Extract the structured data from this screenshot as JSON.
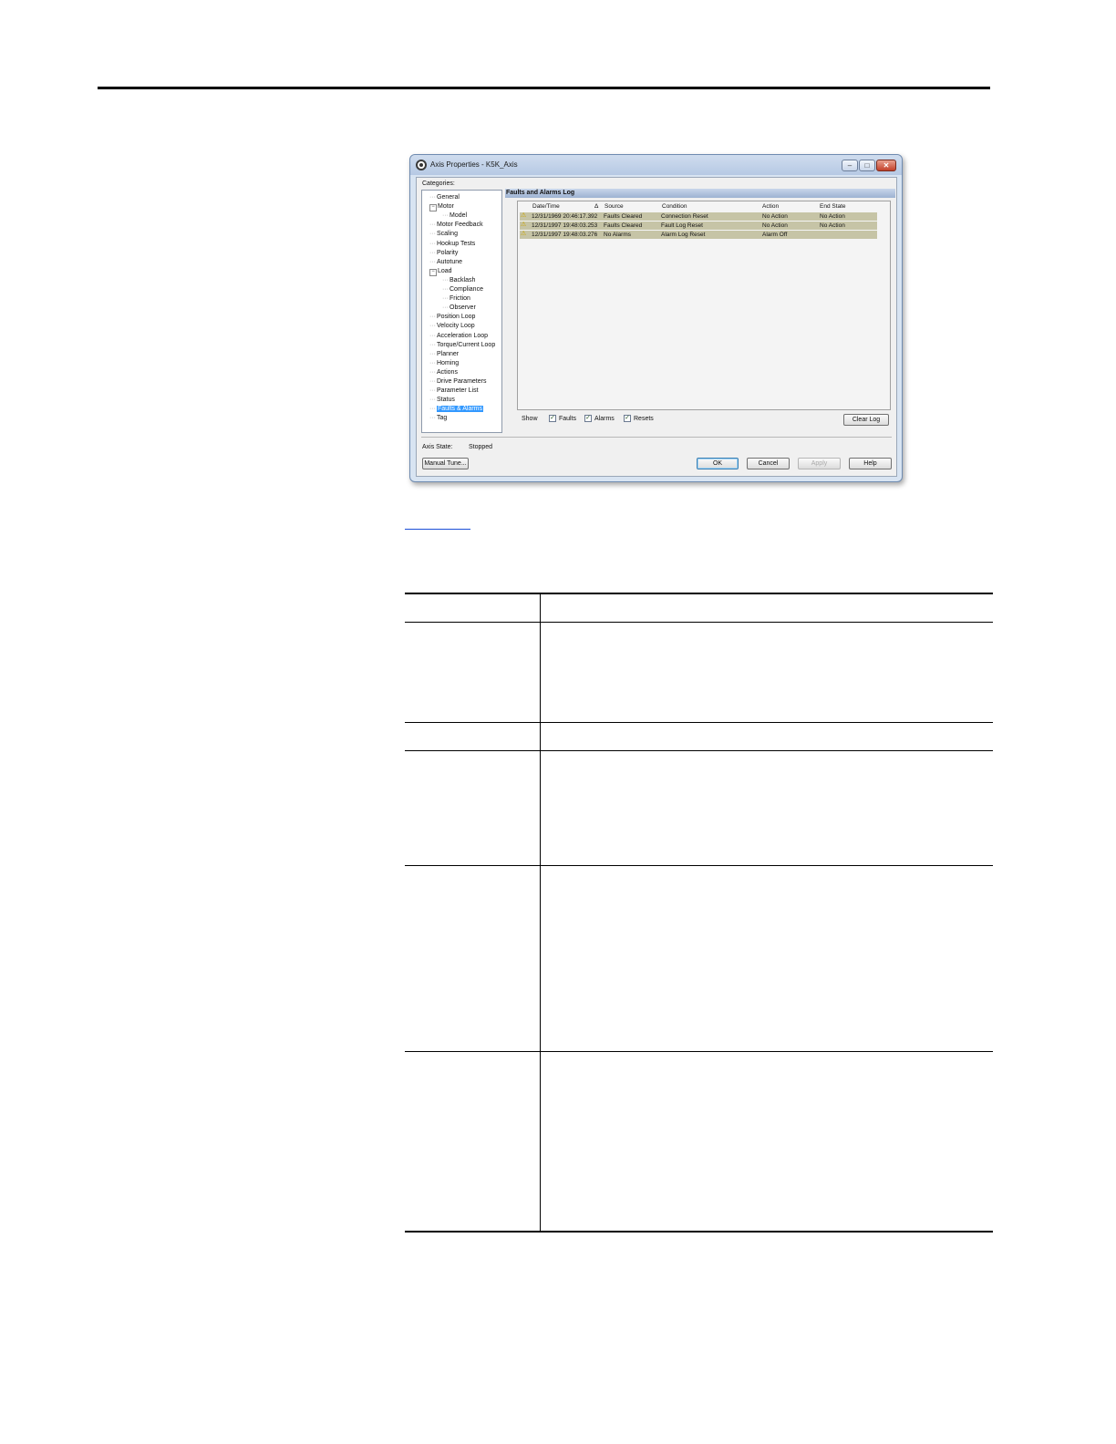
{
  "window": {
    "title": "Axis Properties - K5K_Axis",
    "minimize": "‒",
    "maximize": "□",
    "close": "✕"
  },
  "categories": {
    "label": "Categories:",
    "items": [
      {
        "label": "General",
        "level": 1
      },
      {
        "label": "Motor",
        "level": 1,
        "expander": "−"
      },
      {
        "label": "Model",
        "level": 2
      },
      {
        "label": "Motor Feedback",
        "level": 1
      },
      {
        "label": "Scaling",
        "level": 1
      },
      {
        "label": "Hookup Tests",
        "level": 1
      },
      {
        "label": "Polarity",
        "level": 1
      },
      {
        "label": "Autotune",
        "level": 1
      },
      {
        "label": "Load",
        "level": 1,
        "expander": "−"
      },
      {
        "label": "Backlash",
        "level": 2
      },
      {
        "label": "Compliance",
        "level": 2
      },
      {
        "label": "Friction",
        "level": 2
      },
      {
        "label": "Observer",
        "level": 2
      },
      {
        "label": "Position Loop",
        "level": 1
      },
      {
        "label": "Velocity Loop",
        "level": 1
      },
      {
        "label": "Acceleration Loop",
        "level": 1
      },
      {
        "label": "Torque/Current Loop",
        "level": 1
      },
      {
        "label": "Planner",
        "level": 1
      },
      {
        "label": "Homing",
        "level": 1
      },
      {
        "label": "Actions",
        "level": 1
      },
      {
        "label": "Drive Parameters",
        "level": 1
      },
      {
        "label": "Parameter List",
        "level": 1
      },
      {
        "label": "Status",
        "level": 1
      },
      {
        "label": "Faults & Alarms",
        "level": 1,
        "selected": true
      },
      {
        "label": "Tag",
        "level": 1
      }
    ]
  },
  "log": {
    "header": "Faults and Alarms Log",
    "columns": [
      "Date/Time",
      "Δ",
      "Source",
      "Condition",
      "Action",
      "End State"
    ],
    "rows": [
      {
        "datetime": "12/31/1969 20:46:17.392",
        "source": "Faults Cleared",
        "condition": "Connection Reset",
        "action": "No Action",
        "end_state": "No Action"
      },
      {
        "datetime": "12/31/1997 19:48:03.253",
        "source": "Faults Cleared",
        "condition": "Fault Log Reset",
        "action": "No Action",
        "end_state": "No Action"
      },
      {
        "datetime": "12/31/1997 19:48:03.276",
        "source": "No Alarms",
        "condition": "Alarm Log Reset",
        "action": "Alarm Off",
        "end_state": ""
      }
    ],
    "row_icon": "⚠"
  },
  "filters": {
    "show_label": "Show",
    "check_mark": "✓",
    "faults": "Faults",
    "alarms": "Alarms",
    "resets": "Resets",
    "clear_log": "Clear Log"
  },
  "status": {
    "axis_state_label": "Axis State:",
    "axis_state_value": "Stopped"
  },
  "buttons": {
    "manual_tune": "Manual Tune...",
    "ok": "OK",
    "cancel": "Cancel",
    "apply": "Apply",
    "help": "Help"
  }
}
